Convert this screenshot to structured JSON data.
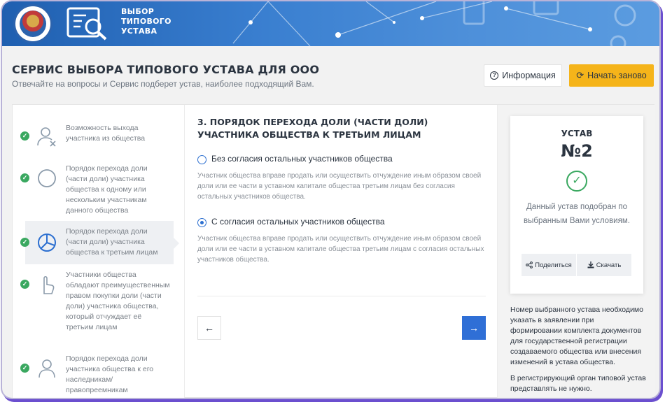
{
  "header": {
    "service_name": "Выбор типового устава"
  },
  "page": {
    "title": "СЕРВИС ВЫБОРА ТИПОВОГО УСТАВА ДЛЯ ООО",
    "subtitle": "Отвечайте на вопросы и Сервис подберет устав, наиболее подходящий Вам.",
    "info_button": "Информация",
    "restart_button": "Начать заново"
  },
  "steps": [
    {
      "text": "Возможность выхода участника из общества",
      "icon": "user-exit-icon",
      "done": true,
      "active": false
    },
    {
      "text": "Порядок перехода доли (части доли) участника общества к одному или нескольким участникам данного общества",
      "icon": "circle-icon",
      "done": true,
      "active": false
    },
    {
      "text": "Порядок перехода доли (части доли) участника общества к третьим лицам",
      "icon": "pie-chart-icon",
      "done": true,
      "active": true
    },
    {
      "text": "Участники общества обладают преимущественным правом покупки доли (части доли) участника общества, который отчуждает её третьим лицам",
      "icon": "hand-pointer-icon",
      "done": true,
      "active": false
    },
    {
      "text": "Порядок перехода доли участника общества к его наследникам/ правопреемникам",
      "icon": "users-icon",
      "done": true,
      "active": false
    }
  ],
  "question": {
    "title": "3. ПОРЯДОК ПЕРЕХОДА ДОЛИ (ЧАСТИ ДОЛИ) УЧАСТНИКА ОБЩЕСТВА К ТРЕТЬИМ ЛИЦАМ",
    "options": [
      {
        "label": "Без согласия остальных участников общества",
        "description": "Участник общества вправе продать или осуществить отчуждение иным образом своей доли или ее части в уставном капитале общества третьим лицам без согласия остальных участников общества.",
        "selected": false
      },
      {
        "label": "С согласия остальных участников общества",
        "description": "Участник общества вправе продать или осуществить отчуждение иным образом своей доли или ее части в уставном капитале общества третьим лицам с согласия остальных участников общества.",
        "selected": true
      }
    ],
    "prev_arrow": "←",
    "next_arrow": "→"
  },
  "result": {
    "label": "УСТАВ",
    "number": "№2",
    "text": "Данный устав подобран по выбранным Вами условиям.",
    "share_button": "Поделиться",
    "download_button": "Скачать",
    "note_1": "Номер выбранного устава необходимо указать в заявлении при формировании комплекта документов для государственной регистрации создаваемого общества или внесения изменений в устава общества.",
    "note_2": "В регистрирующий орган типовой устав представлять не нужно."
  },
  "colors": {
    "banner": "#3a7fd0",
    "accent_yellow": "#f5b41a",
    "accent_blue": "#2f6fd6",
    "success_green": "#3aa860"
  }
}
